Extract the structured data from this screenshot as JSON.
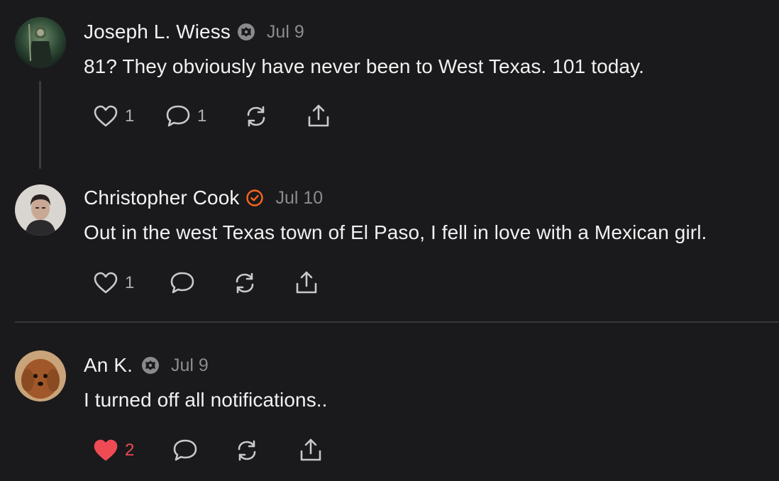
{
  "comments": [
    {
      "author": "Joseph L. Wiess",
      "badge": "subscriber-badge-icon",
      "date": "Jul 9",
      "text": "81? They obviously have never been to West Texas. 101 today.",
      "likes": "1",
      "replies": "1",
      "liked": false
    },
    {
      "author": "Christopher Cook",
      "badge": "author-check-badge-icon",
      "date": "Jul 10",
      "text": "Out in the west Texas town of El Paso, I fell in love with a Mexican girl.",
      "likes": "1",
      "replies": "",
      "liked": false
    },
    {
      "author": "An K.",
      "badge": "subscriber-badge-icon",
      "date": "Jul 9",
      "text": "I turned off all notifications..",
      "likes": "2",
      "replies": "",
      "liked": true
    }
  ],
  "colors": {
    "background": "#1a1a1c",
    "accent_badge": "#ff6719",
    "liked": "#ef4b55",
    "muted": "#8c8c90"
  }
}
